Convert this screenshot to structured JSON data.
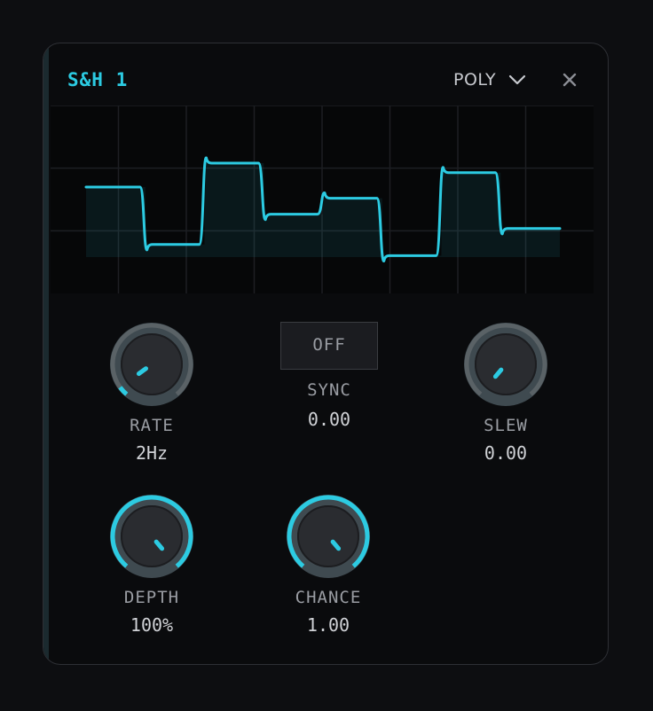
{
  "module": {
    "title": "S&H 1",
    "mode": "POLY",
    "accent_color": "#2ccbe2",
    "icons": {
      "mode_dropdown": "chevron-down-icon",
      "close": "close-icon"
    }
  },
  "waveform": {
    "type": "sample-and-hold",
    "levels": [
      0.6,
      0.24,
      0.75,
      0.43,
      0.53,
      0.17,
      0.69,
      0.34
    ]
  },
  "controls": {
    "rate": {
      "label": "RATE",
      "value": "2Hz",
      "level": 0.05
    },
    "sync": {
      "label": "SYNC",
      "button": "OFF",
      "value": "0.00"
    },
    "slew": {
      "label": "SLEW",
      "value": "0.00",
      "level": 0.0
    },
    "depth": {
      "label": "DEPTH",
      "value": "100%",
      "level": 1.0
    },
    "chance": {
      "label": "CHANCE",
      "value": "1.00",
      "level": 1.0
    }
  }
}
